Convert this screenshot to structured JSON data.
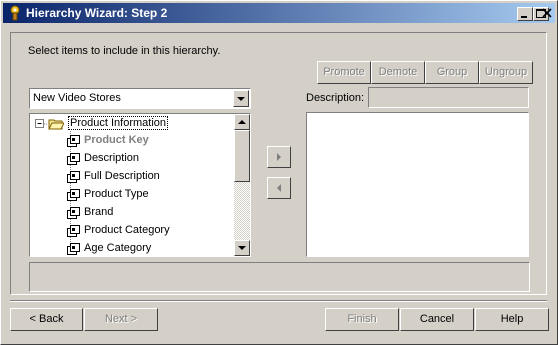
{
  "window": {
    "title": "Hierarchy Wizard: Step 2"
  },
  "instructions": "Select items to include in this hierarchy.",
  "toolbar": {
    "promote": "Promote",
    "demote": "Demote",
    "group": "Group",
    "ungroup": "Ungroup"
  },
  "source_select": {
    "value": "New Video Stores"
  },
  "description_label": "Description:",
  "tree": {
    "root": "Product Information",
    "items": [
      {
        "label": "Product Key",
        "dim": true
      },
      {
        "label": "Description"
      },
      {
        "label": "Full Description"
      },
      {
        "label": "Product Type"
      },
      {
        "label": "Brand"
      },
      {
        "label": "Product Category"
      },
      {
        "label": "Age Category"
      }
    ]
  },
  "footer": {
    "back": "< Back",
    "next": "Next >",
    "finish": "Finish",
    "cancel": "Cancel",
    "help": "Help"
  },
  "colors": {
    "title_start": "#0a246a",
    "title_end": "#a6caf0",
    "face": "#d4d0c8",
    "selection": "#000080"
  }
}
